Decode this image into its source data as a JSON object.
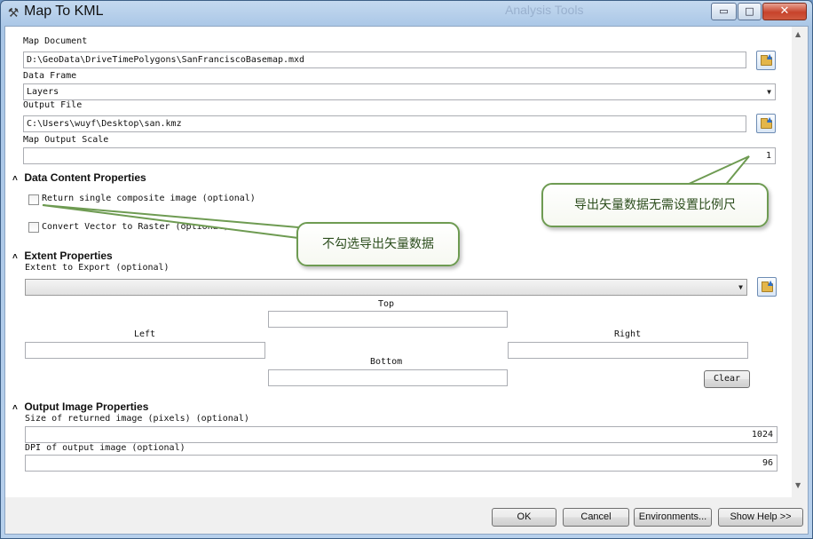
{
  "window": {
    "title": "Map To KML",
    "background_ghost": "Analysis Tools",
    "controls": {
      "minimize": "▭",
      "maximize": "□",
      "close": "✕"
    }
  },
  "params": {
    "map_document": {
      "label": "Map Document",
      "value": "D:\\GeoData\\DriveTimePolygons\\SanFranciscoBasemap.mxd"
    },
    "data_frame": {
      "label": "Data Frame",
      "value": "Layers"
    },
    "output_file": {
      "label": "Output File",
      "value": "C:\\Users\\wuyf\\Desktop\\san.kmz"
    },
    "map_output_scale": {
      "label": "Map Output Scale",
      "value": "1"
    }
  },
  "sections": {
    "data_content": {
      "title": "Data Content Properties",
      "return_single": "Return single composite image (optional)",
      "convert_vector": "Convert Vector to Raster (optional)"
    },
    "extent": {
      "title": "Extent Properties",
      "extent_label": "Extent to Export (optional)",
      "top": "Top",
      "left": "Left",
      "right": "Right",
      "bottom": "Bottom",
      "clear": "Clear"
    },
    "output_image": {
      "title": "Output Image Properties",
      "size_label": "Size of returned image (pixels) (optional)",
      "size_value": "1024",
      "dpi_label": "DPI of output image (optional)",
      "dpi_value": "96"
    }
  },
  "callouts": {
    "scale_note": "导出矢量数据无需设置比例尺",
    "checkbox_note": "不勾选导出矢量数据"
  },
  "footer": {
    "ok": "OK",
    "cancel": "Cancel",
    "environments": "Environments...",
    "show_help": "Show Help >>"
  },
  "colors": {
    "callout_border": "#6e9b52",
    "callout_text": "#2d4e1e",
    "title_bar": "#a9c6e6"
  },
  "icons": {
    "title": "hammer-icon",
    "browse": "open-folder-icon",
    "collapse": "chevron-up-icon",
    "dropdown": "chevron-down-icon"
  }
}
